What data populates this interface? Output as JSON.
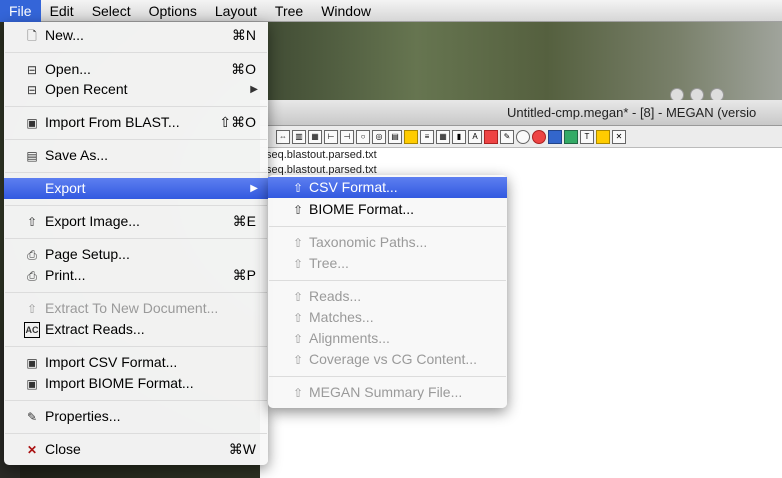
{
  "menubar": {
    "items": [
      "File",
      "Edit",
      "Select",
      "Options",
      "Layout",
      "Tree",
      "Window"
    ]
  },
  "window": {
    "title": "Untitled-cmp.megan* - [8] - MEGAN (versio",
    "files": [
      "seq.blastout.parsed.txt",
      "seq.blastout.parsed.txt"
    ]
  },
  "file_menu": {
    "new": {
      "label": "New...",
      "shortcut": "⌘N",
      "icon": "document-icon"
    },
    "open": {
      "label": "Open...",
      "shortcut": "⌘O",
      "icon": "open-folder-icon"
    },
    "open_recent": {
      "label": "Open Recent",
      "icon": "open-folder-icon"
    },
    "import_blast": {
      "label": "Import From BLAST...",
      "shortcut": "⇧⌘O",
      "icon": "import-icon"
    },
    "save_as": {
      "label": "Save As...",
      "icon": "save-icon"
    },
    "export": {
      "label": "Export"
    },
    "export_image": {
      "label": "Export Image...",
      "shortcut": "⌘E",
      "icon": "export-icon"
    },
    "page_setup": {
      "label": "Page Setup...",
      "icon": "printer-icon"
    },
    "print": {
      "label": "Print...",
      "shortcut": "⌘P",
      "icon": "printer-icon"
    },
    "extract_new": {
      "label": "Extract To New Document...",
      "icon": "export-icon"
    },
    "extract_reads": {
      "label": "Extract Reads...",
      "icon": "reads-icon",
      "icon_text": "AC"
    },
    "import_csv": {
      "label": "Import CSV Format...",
      "icon": "import-icon"
    },
    "import_biome": {
      "label": "Import BIOME Format...",
      "icon": "import-icon"
    },
    "properties": {
      "label": "Properties...",
      "icon": "properties-icon"
    },
    "close": {
      "label": "Close",
      "shortcut": "⌘W",
      "icon": "close-icon"
    }
  },
  "export_submenu": {
    "items": [
      {
        "label": "CSV Format...",
        "enabled": true,
        "highlighted": true
      },
      {
        "label": "BIOME Format...",
        "enabled": true
      },
      {
        "label": "Taxonomic Paths...",
        "enabled": false
      },
      {
        "label": "Tree...",
        "enabled": false
      },
      {
        "label": "Reads...",
        "enabled": false
      },
      {
        "label": "Matches...",
        "enabled": false
      },
      {
        "label": "Alignments...",
        "enabled": false
      },
      {
        "label": "Coverage vs CG Content...",
        "enabled": false
      },
      {
        "label": "MEGAN Summary File...",
        "enabled": false
      }
    ]
  },
  "colors": {
    "highlight": "#3259e0",
    "disabled_text": "#9a9a9a",
    "menu_bg": "#f8f8f8"
  }
}
